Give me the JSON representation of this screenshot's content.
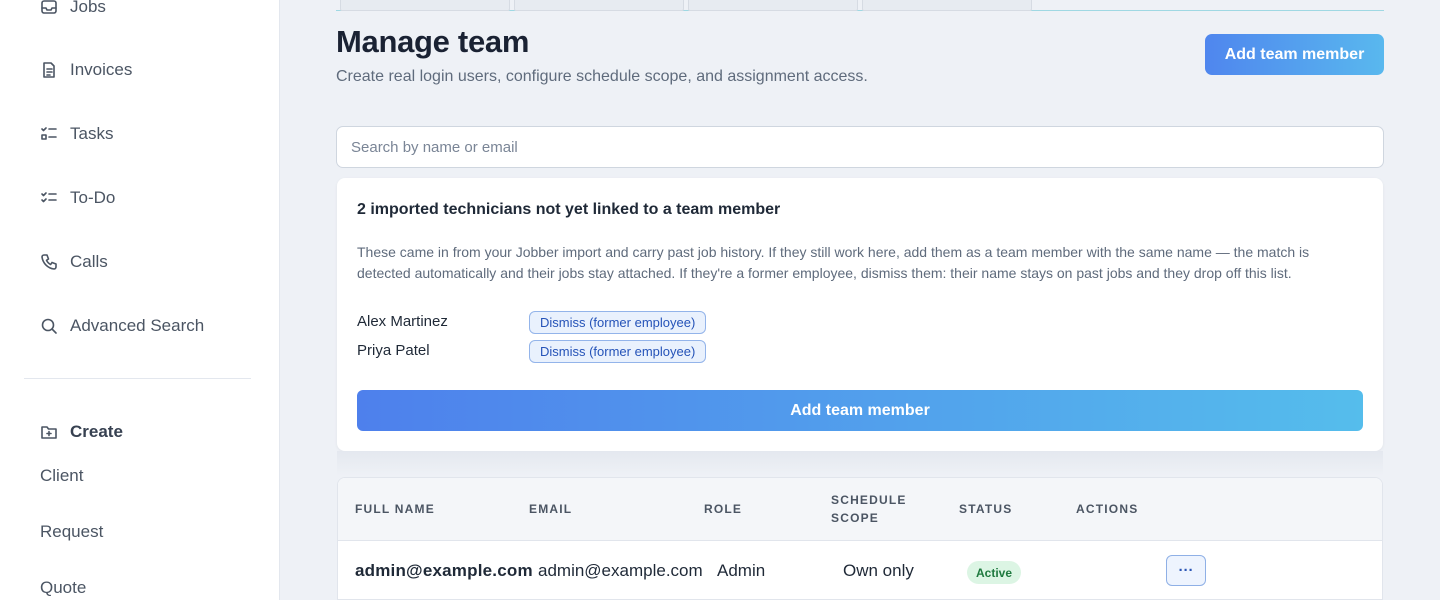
{
  "sidebar": {
    "items": [
      {
        "label": "Jobs",
        "icon": "inbox-icon"
      },
      {
        "label": "Invoices",
        "icon": "document-icon"
      },
      {
        "label": "Tasks",
        "icon": "task-list-icon"
      },
      {
        "label": "To-Do",
        "icon": "checklist-icon"
      },
      {
        "label": "Calls",
        "icon": "phone-icon"
      },
      {
        "label": "Advanced Search",
        "icon": "search-icon"
      }
    ],
    "create": {
      "label": "Create",
      "icon": "folder-plus-icon"
    },
    "create_items": [
      "Client",
      "Request",
      "Quote"
    ]
  },
  "header": {
    "title": "Manage team",
    "subtitle": "Create real login users, configure schedule scope, and assignment access.",
    "add_button": "Add team member"
  },
  "search": {
    "placeholder": "Search by name or email",
    "value": ""
  },
  "imported_card": {
    "title": "2 imported technicians not yet linked to a team member",
    "description": "These came in from your Jobber import and carry past job history. If they still work here, add them as a team member with the same name — the match is detected automatically and their jobs stay attached. If they're a former employee, dismiss them: their name stays on past jobs and they drop off this list.",
    "technicians": [
      {
        "name": "Alex Martinez",
        "action": "Dismiss (former employee)"
      },
      {
        "name": "Priya Patel",
        "action": "Dismiss (former employee)"
      }
    ],
    "add_button": "Add team member"
  },
  "table": {
    "columns": [
      "FULL NAME",
      "EMAIL",
      "ROLE",
      "SCHEDULE SCOPE",
      "STATUS",
      "ACTIONS"
    ],
    "rows": [
      {
        "full_name": "admin@example.com",
        "email": "admin@example.com",
        "role": "Admin",
        "schedule_scope": "Own only",
        "status": "Active",
        "actions": "···"
      }
    ]
  },
  "colors": {
    "accent_gradient_start": "#4f86ee",
    "accent_gradient_end": "#59b8ee",
    "status_active_bg": "#dcf5e4",
    "status_active_text": "#1f7a3f"
  }
}
